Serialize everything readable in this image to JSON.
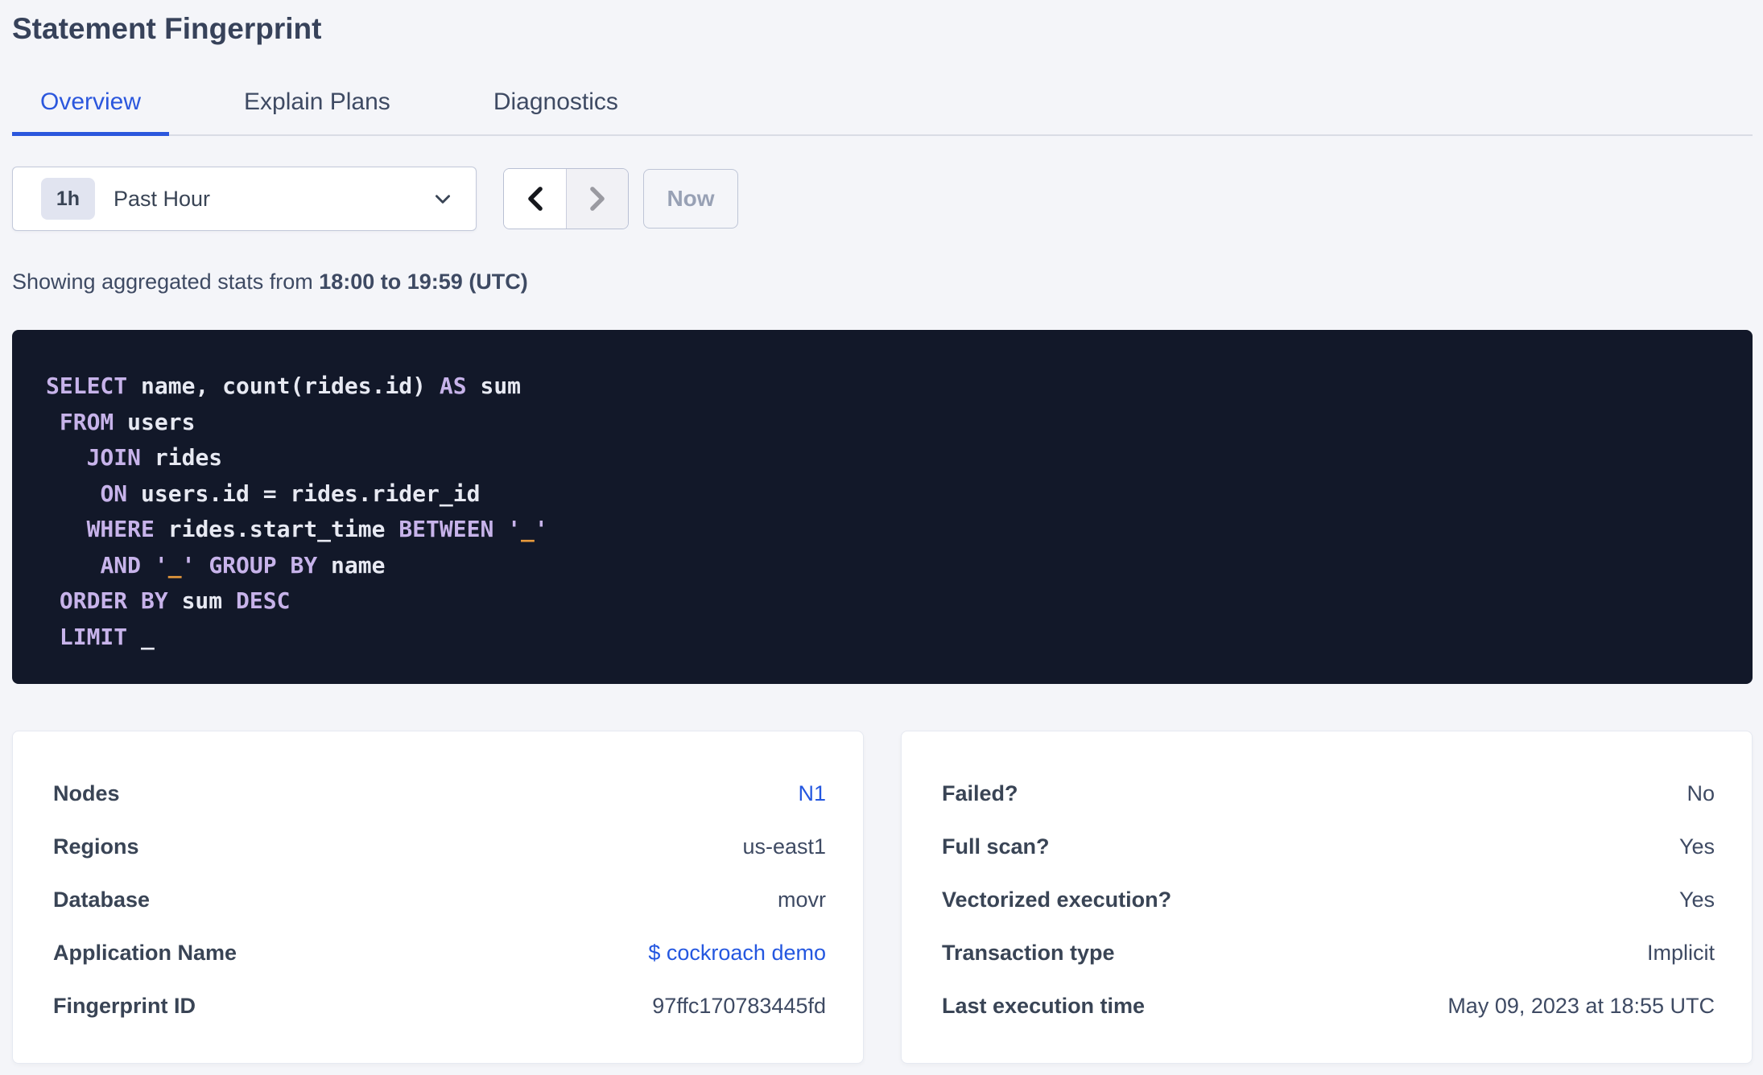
{
  "page": {
    "title": "Statement Fingerprint"
  },
  "tabs": [
    {
      "label": "Overview",
      "active": true
    },
    {
      "label": "Explain Plans",
      "active": false
    },
    {
      "label": "Diagnostics",
      "active": false
    }
  ],
  "time_controls": {
    "range_badge": "1h",
    "range_label": "Past Hour",
    "now_label": "Now",
    "icons": {
      "open_dropdown": "chevron-down-icon",
      "prev": "chevron-left-icon",
      "next": "chevron-right-icon"
    },
    "prev_enabled": true,
    "next_enabled": false
  },
  "stats_line": {
    "prefix": "Showing aggregated stats from ",
    "range": "18:00 to 19:59 (UTC)"
  },
  "sql": {
    "lines": [
      [
        {
          "t": "SELECT",
          "c": "kw"
        },
        {
          "t": " name, count(rides.id) ",
          "c": "id"
        },
        {
          "t": "AS",
          "c": "kw"
        },
        {
          "t": " sum",
          "c": "id"
        }
      ],
      [
        {
          "t": " ",
          "c": "id"
        },
        {
          "t": "FROM",
          "c": "kw"
        },
        {
          "t": " users",
          "c": "id"
        }
      ],
      [
        {
          "t": "   ",
          "c": "id"
        },
        {
          "t": "JOIN",
          "c": "kw"
        },
        {
          "t": " rides",
          "c": "id"
        }
      ],
      [
        {
          "t": "    ",
          "c": "id"
        },
        {
          "t": "ON",
          "c": "kw"
        },
        {
          "t": " users.id = rides.rider_id",
          "c": "id"
        }
      ],
      [
        {
          "t": "   ",
          "c": "id"
        },
        {
          "t": "WHERE",
          "c": "kw"
        },
        {
          "t": " rides.start_time ",
          "c": "id"
        },
        {
          "t": "BETWEEN",
          "c": "kw"
        },
        {
          "t": " ",
          "c": "id"
        },
        {
          "t": "'",
          "c": "kw"
        },
        {
          "t": "_",
          "c": "str"
        },
        {
          "t": "'",
          "c": "kw"
        }
      ],
      [
        {
          "t": "    ",
          "c": "id"
        },
        {
          "t": "AND",
          "c": "kw"
        },
        {
          "t": " ",
          "c": "id"
        },
        {
          "t": "'",
          "c": "kw"
        },
        {
          "t": "_",
          "c": "str"
        },
        {
          "t": "'",
          "c": "kw"
        },
        {
          "t": " ",
          "c": "id"
        },
        {
          "t": "GROUP BY",
          "c": "kw"
        },
        {
          "t": " name",
          "c": "id"
        }
      ],
      [
        {
          "t": " ",
          "c": "id"
        },
        {
          "t": "ORDER BY",
          "c": "kw"
        },
        {
          "t": " sum ",
          "c": "id"
        },
        {
          "t": "DESC",
          "c": "kw"
        }
      ],
      [
        {
          "t": " ",
          "c": "id"
        },
        {
          "t": "LIMIT",
          "c": "kw"
        },
        {
          "t": " _",
          "c": "id"
        }
      ]
    ]
  },
  "cards": {
    "left": {
      "rows": [
        {
          "label": "Nodes",
          "value": "N1",
          "link": true
        },
        {
          "label": "Regions",
          "value": "us-east1",
          "link": false
        },
        {
          "label": "Database",
          "value": "movr",
          "link": false
        },
        {
          "label": "Application Name",
          "value": "$ cockroach demo",
          "link": true
        },
        {
          "label": "Fingerprint ID",
          "value": "97ffc170783445fd",
          "link": false
        }
      ]
    },
    "right": {
      "rows": [
        {
          "label": "Failed?",
          "value": "No",
          "link": false
        },
        {
          "label": "Full scan?",
          "value": "Yes",
          "link": false
        },
        {
          "label": "Vectorized execution?",
          "value": "Yes",
          "link": false
        },
        {
          "label": "Transaction type",
          "value": "Implicit",
          "link": false
        },
        {
          "label": "Last execution time",
          "value": "May 09, 2023 at 18:55 UTC",
          "link": false
        }
      ]
    }
  },
  "colors": {
    "accent_blue": "#2b57dd",
    "link_blue": "#2457e0",
    "sql_background": "#121829",
    "sql_keyword": "#c7b3ea",
    "sql_identifier": "#e7e9f2",
    "sql_placeholder": "#e89a3c",
    "page_background": "#f4f5f9",
    "text_dark": "#394455"
  }
}
